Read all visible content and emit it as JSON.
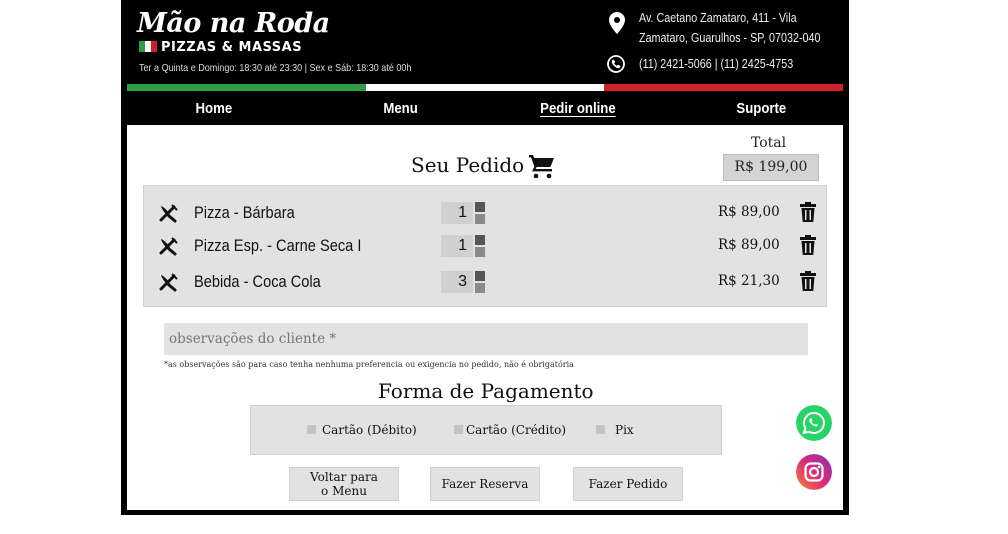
{
  "header": {
    "logo_script": "Mão na Roda",
    "logo_sub": "PIZZAS & MASSAS",
    "hours": "Ter a Quinta e Domingo: 18:30 até 23:30 | Sex e Sáb: 18:30 até 00h",
    "address_line1": "Av. Caetano Zamataro, 411 - Vila",
    "address_line2": "Zamataro, Guarulhos - SP, 07032-040",
    "phones": "(11) 2421-5066 | (11) 2425-4753",
    "flag_colors": [
      "#2e9e46",
      "#ffffff",
      "#d0202a"
    ]
  },
  "nav": {
    "items": [
      "Home",
      "Menu",
      "Pedir online",
      "Suporte"
    ],
    "active": "Pedir online"
  },
  "order": {
    "title": "Seu Pedido",
    "total_label": "Total",
    "total_value": "R$ 199,00",
    "items": [
      {
        "name": "Pizza - Bárbara",
        "qty": "1",
        "price": "R$ 89,00"
      },
      {
        "name": "Pizza Esp. - Carne Seca I",
        "qty": "1",
        "price": "R$ 89,00"
      },
      {
        "name": "Bebida - Coca Cola",
        "qty": "3",
        "price": "R$ 21,30"
      }
    ]
  },
  "observations": {
    "placeholder": "observações do cliente *",
    "note": "*as observações são para caso tenha nenhuma preferencia ou exigencia no pedido, não é obrigatória"
  },
  "payment": {
    "title": "Forma de Pagamento",
    "options": [
      "Cartão (Débito)",
      "Cartão (Crédito)",
      "Pix"
    ]
  },
  "buttons": {
    "back_line1": "Voltar para",
    "back_line2": "o Menu",
    "reserve": "Fazer Reserva",
    "order": "Fazer Pedido"
  },
  "social": {
    "whatsapp_color": "#25d366",
    "instagram_colors": [
      "#f58529",
      "#dd2a7b",
      "#8134af"
    ]
  }
}
